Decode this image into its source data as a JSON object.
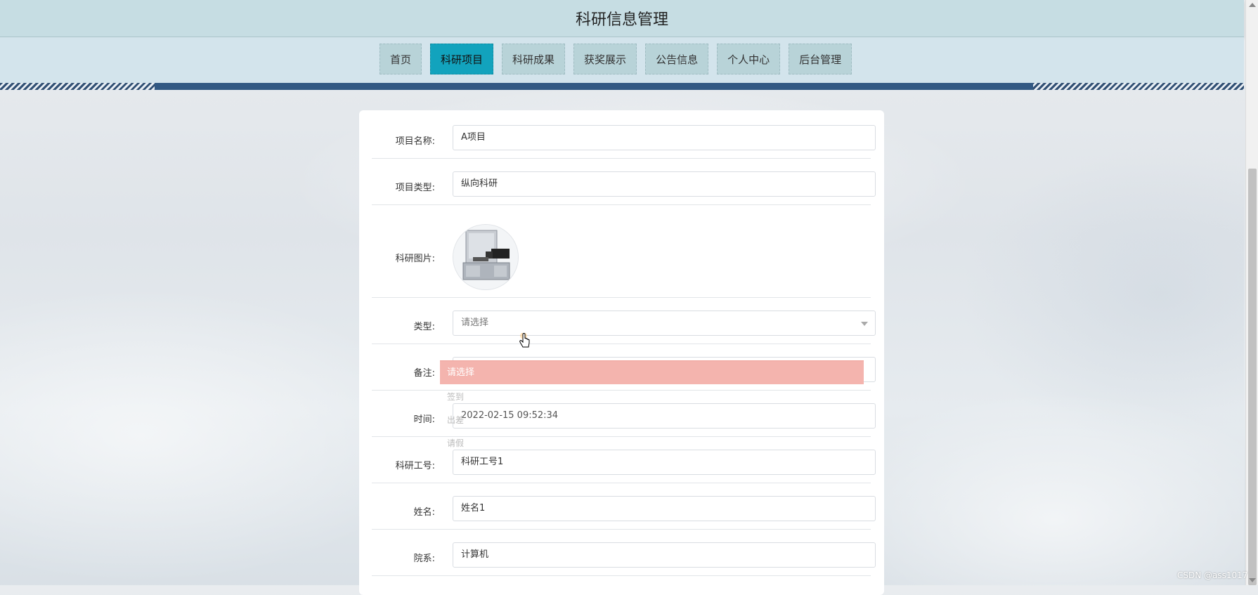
{
  "header": {
    "title": "科研信息管理"
  },
  "nav": {
    "items": [
      {
        "label": "首页"
      },
      {
        "label": "科研项目"
      },
      {
        "label": "科研成果"
      },
      {
        "label": "获奖展示"
      },
      {
        "label": "公告信息"
      },
      {
        "label": "个人中心"
      },
      {
        "label": "后台管理"
      }
    ],
    "active_index": 1
  },
  "form": {
    "project_name": {
      "label": "项目名称:",
      "value": "A项目"
    },
    "project_type": {
      "label": "项目类型:",
      "value": "纵向科研"
    },
    "image": {
      "label": "科研图片:"
    },
    "type": {
      "label": "类型:",
      "placeholder": "请选择"
    },
    "remark": {
      "label": "备注:"
    },
    "time": {
      "label": "时间:",
      "value": "2022-02-15 09:52:34"
    },
    "staff_no": {
      "label": "科研工号:",
      "value": "科研工号1"
    },
    "name": {
      "label": "姓名:",
      "value": "姓名1"
    },
    "department": {
      "label": "院系:",
      "value": "计算机"
    }
  },
  "dropdown": {
    "head": "请选择",
    "options": [
      "签到",
      "出差",
      "请假"
    ]
  },
  "watermark": "CSDN @ass1017",
  "colors": {
    "active_nav": "#12a3bd",
    "dropdown_highlight": "#f4b4ae"
  }
}
